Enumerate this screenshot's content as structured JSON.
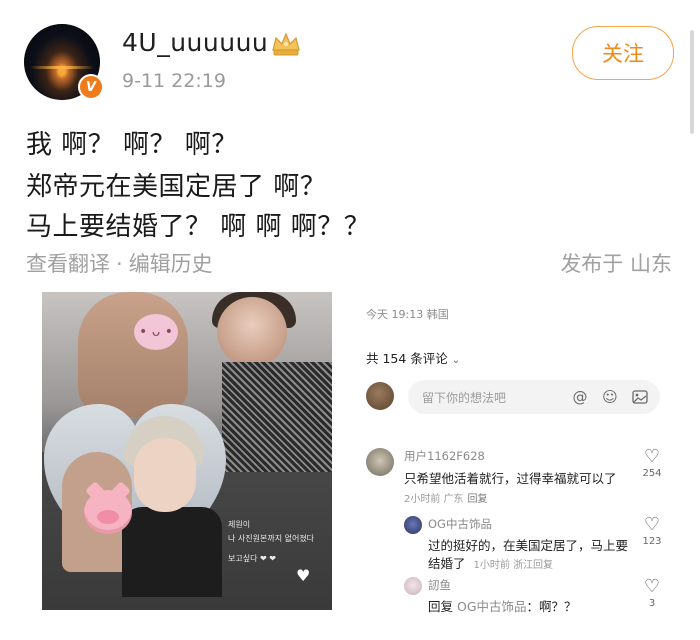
{
  "author": {
    "name": "4U_uuuuuu",
    "time": "9-11 22:19",
    "verified_badge": "V",
    "follow_label": "关注"
  },
  "post": {
    "lines": [
      "我 啊？ 啊？ 啊？",
      "郑帝元在美国定居了 啊？",
      "马上要结婚了？ 啊 啊 啊？？"
    ],
    "translate": "查看翻译",
    "separator": "·",
    "edit_history": "编辑历史",
    "location": "发布于 山东"
  },
  "photo": {
    "korean_lines": [
      "제원이",
      "나   사진원본까지   없어졌다",
      "보고싶다 ❤ ❤"
    ]
  },
  "embedded_panel": {
    "date": "今天 19:13 韩国",
    "comment_count": "共 154 条评论",
    "input_placeholder": "留下你的想法吧",
    "comments": [
      {
        "user": "用户1162F628",
        "text": "只希望他活着就行，过得幸福就可以了",
        "meta": "2小时前 广东",
        "reply_label": "回复",
        "likes": "254"
      },
      {
        "user": "OG中古饰品",
        "text": "过的挺好的，在美国定居了，马上要",
        "text2": "结婚了",
        "meta": "1小时前 浙江",
        "reply_label": "回复",
        "likes": "123"
      },
      {
        "user": "訒鱼",
        "reply_prefix": "回复",
        "reply_to": "OG中古饰品",
        "text": "：啊？？",
        "likes": "3"
      }
    ]
  },
  "colors": {
    "accent": "#f08a1a",
    "muted": "#a0a0a0",
    "badge": "#f07b1a"
  },
  "icons": [
    "crown-icon",
    "verified-v-icon",
    "at-icon",
    "smile-icon",
    "image-icon",
    "heart-icon",
    "chevron-down-icon"
  ]
}
